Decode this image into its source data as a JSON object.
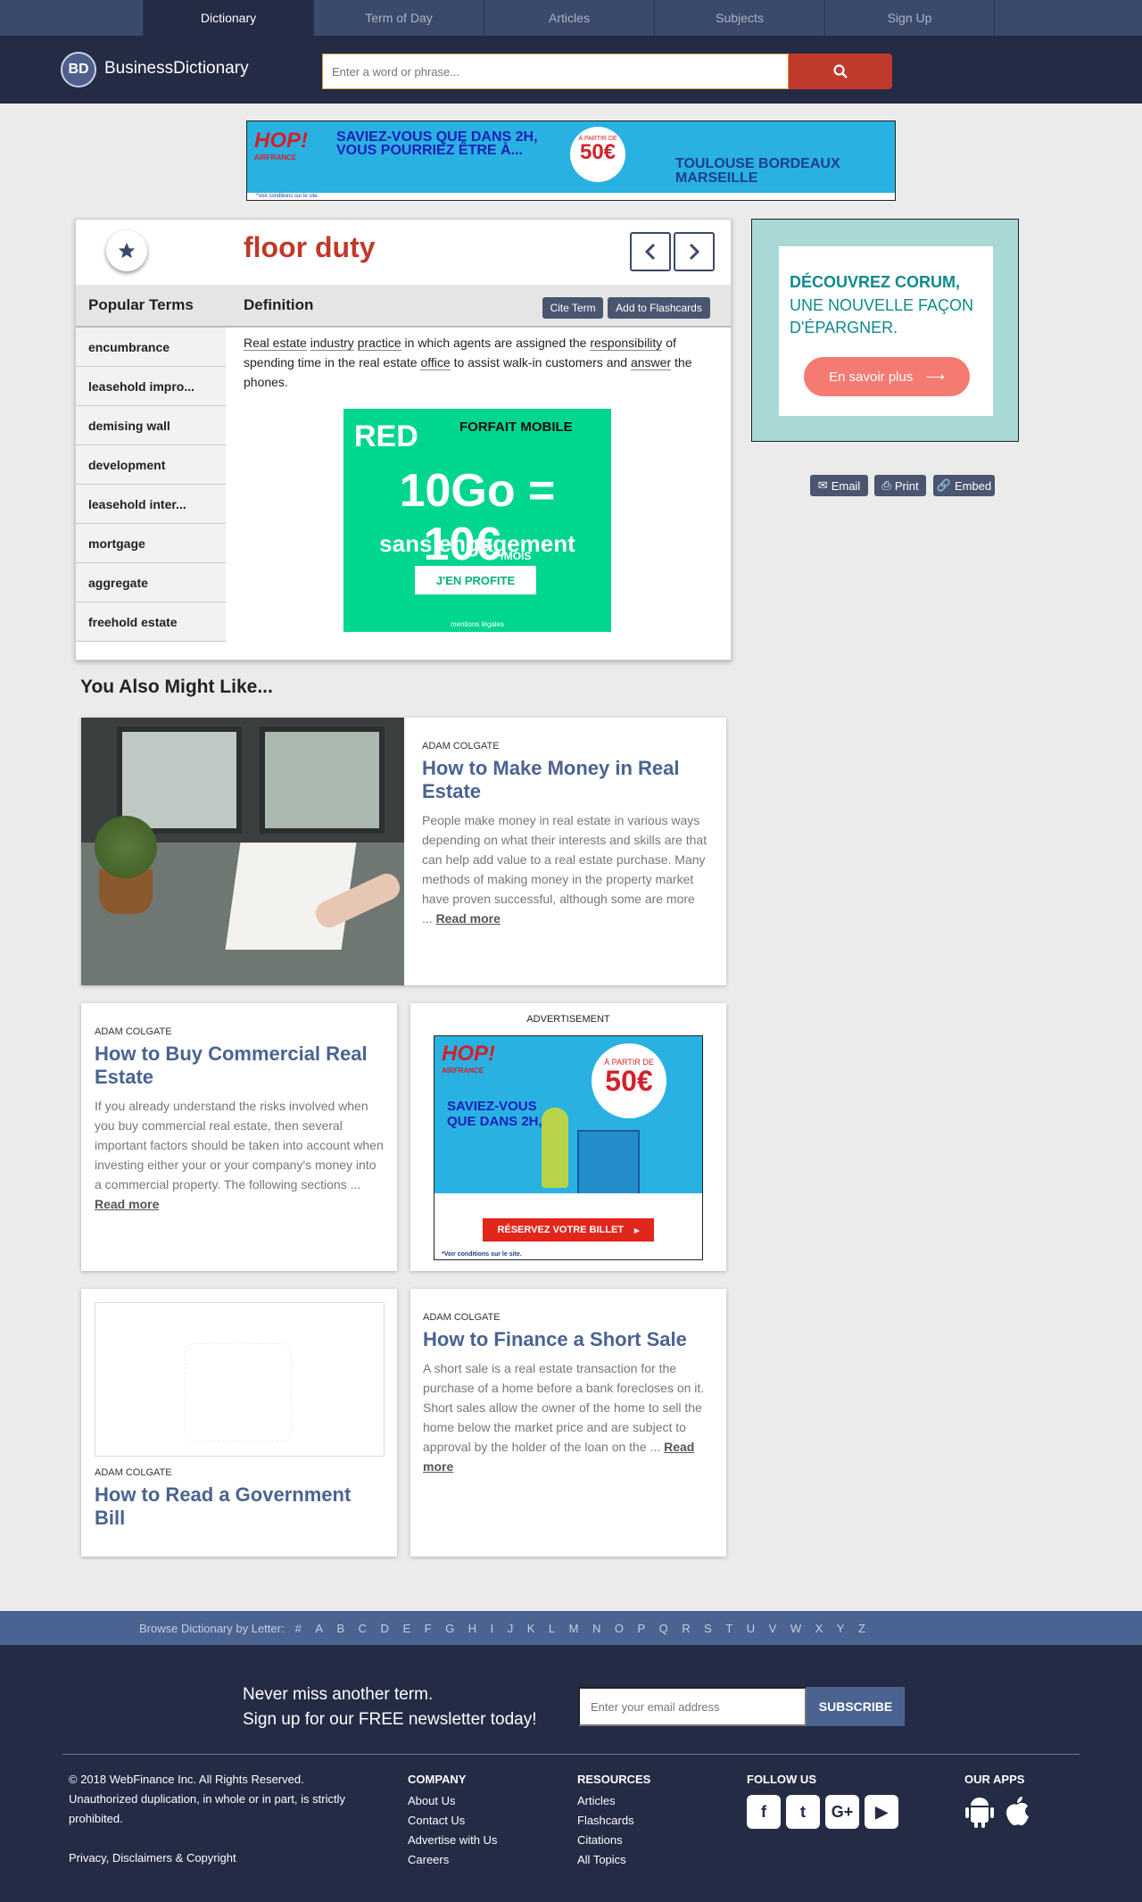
{
  "topnav": {
    "tabs": [
      "Dictionary",
      "Term of Day",
      "Articles",
      "Subjects",
      "Sign Up"
    ]
  },
  "header": {
    "logo_badge": "BD",
    "logo_text": "BusinessDictionary",
    "search_placeholder": "Enter a word or phrase..."
  },
  "ad_top": {
    "brand": "HOP!",
    "brand_sub": "AIRFRANCE",
    "message": "SAVIEZ-VOUS QUE DANS 2H, VOUS POURRIEZ ÊTRE À...",
    "badge_top": "À PARTIR DE",
    "badge_price": "50€",
    "cities": "TOULOUSE BORDEAUX MARSEILLE",
    "conditions": "*Voir conditions sur le site."
  },
  "term": {
    "title": "floor duty"
  },
  "subbar": {
    "popular_label": "Popular Terms",
    "definition_label": "Definition",
    "cite_label": "Cite Term",
    "flashcard_label": "Add to Flashcards"
  },
  "popular_terms": [
    "encumbrance",
    "leasehold impro...",
    "demising wall",
    "development",
    "leasehold inter...",
    "mortgage",
    "aggregate",
    "freehold estate"
  ],
  "definition": {
    "w1": "Real estate",
    "w2": "industry",
    "w3": "practice",
    "t1": " in which agents are assigned the ",
    "w4": "responsibility",
    "t2": " of spending time in the real estate ",
    "w5": "office",
    "t3": " to assist walk-in customers and ",
    "w6": "answer",
    "t4": " the phones."
  },
  "ad_red": {
    "brand": "RED",
    "headline": "FORFAIT MOBILE",
    "price": "10Go = 10€",
    "unit": "/MOIS",
    "tagline": "sans engagement",
    "cta": "J'EN PROFITE",
    "legal": "mentions légales"
  },
  "side_ad": {
    "title": "DÉCOUVREZ CORUM,",
    "subtitle": "UNE NOUVELLE FAÇON D'ÉPARGNER.",
    "cta": "En savoir plus"
  },
  "share": {
    "email": "Email",
    "print": "Print",
    "embed": "Embed"
  },
  "section_title": "You Also Might Like...",
  "articles": [
    {
      "author": "ADAM COLGATE",
      "title": "How to Make Money in Real Estate",
      "text": "People make money in real estate in various ways depending on what their interests and skills are that can help add value to a real estate purchase. Many methods of making money in the property market have proven successful, although some are more ...",
      "read": "Read more"
    },
    {
      "author": "ADAM COLGATE",
      "title": "How to Buy Commercial Real Estate",
      "text": "If you already understand the risks involved when you buy commercial real estate, then several important factors should be taken into account when investing either your or your company's money into a commercial property. The following sections ...",
      "read": "Read more"
    },
    {
      "author": "ADAM COLGATE",
      "title": "How to Read a Government Bill"
    },
    {
      "author": "ADAM COLGATE",
      "title": "How to Finance a Short Sale",
      "text": "A short sale is a real estate transaction for the purchase of a home before a bank forecloses on it. Short sales allow the owner of the home to sell the home below the market price and are subject to approval by the holder of the loan on the ...",
      "read": "Read more"
    }
  ],
  "ad2": {
    "label": "ADVERTISEMENT",
    "brand": "HOP!",
    "brand_sub": "AIRFRANCE",
    "message": "SAVIEZ-VOUS QUE DANS 2H,",
    "badge_top": "À PARTIR DE",
    "badge_price": "50€",
    "cta": "RÉSERVEZ VOTRE BILLET",
    "conditions": "*Voir conditions sur le site."
  },
  "browse": {
    "label": "Browse Dictionary by Letter:",
    "letters": [
      "#",
      "A",
      "B",
      "C",
      "D",
      "E",
      "F",
      "G",
      "H",
      "I",
      "J",
      "K",
      "L",
      "M",
      "N",
      "O",
      "P",
      "Q",
      "R",
      "S",
      "T",
      "U",
      "V",
      "W",
      "X",
      "Y",
      "Z"
    ]
  },
  "footer": {
    "newsletter_1": "Never miss another term.",
    "newsletter_2": "Sign up for our FREE newsletter today!",
    "email_placeholder": "Enter your email address",
    "subscribe": "SUBSCRIBE",
    "copyright": "© 2018 WebFinance Inc. All Rights Reserved.",
    "unauth": "Unauthorized duplication, in whole or in part, is strictly prohibited.",
    "privacy": "Privacy, Disclaimers & Copyright",
    "company_title": "COMPANY",
    "company": [
      "About Us",
      "Contact Us",
      "Advertise with Us",
      "Careers"
    ],
    "resources_title": "RESOURCES",
    "resources": [
      "Articles",
      "Flashcards",
      "Citations",
      "All Topics"
    ],
    "follow_title": "FOLLOW US",
    "apps_title": "OUR APPS"
  },
  "colors": {
    "navy": "#232b45",
    "accent_red": "#c0392b",
    "link_blue": "#4a6391"
  }
}
